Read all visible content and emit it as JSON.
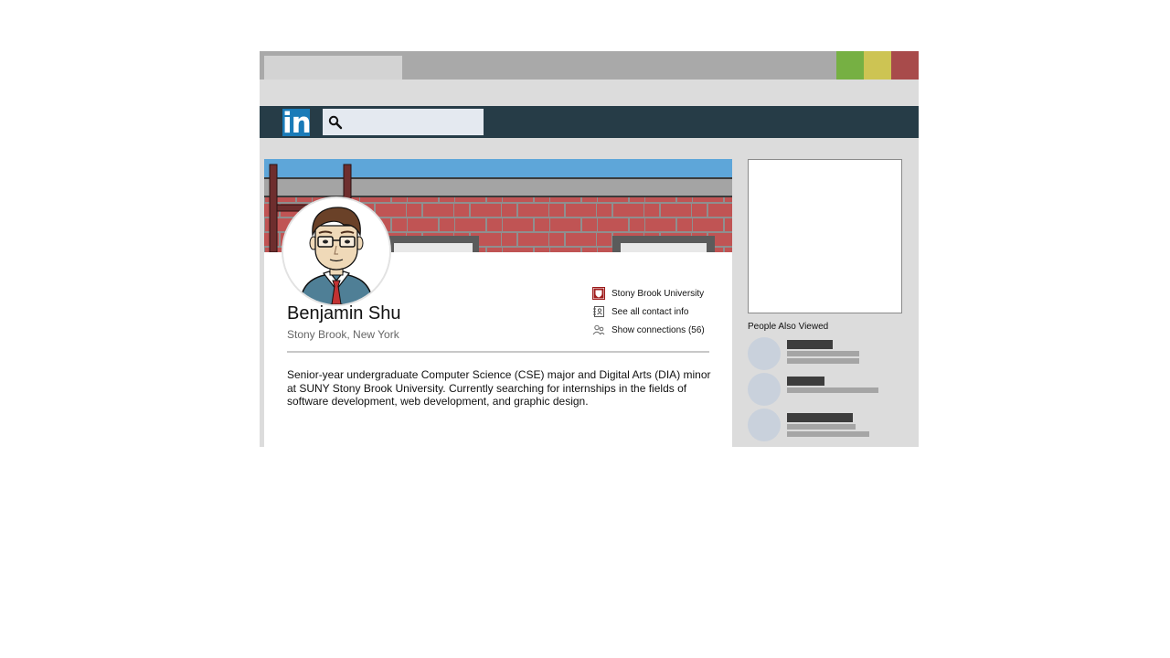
{
  "browser": {
    "window_buttons": [
      {
        "name": "maximize",
        "color": "#76b043"
      },
      {
        "name": "minimize",
        "color": "#cdc453"
      },
      {
        "name": "close",
        "color": "#a84b4b"
      }
    ]
  },
  "navbar": {
    "logo_text": "in",
    "logo_color": "#1a7bb8",
    "background": "#263c47",
    "search": {
      "icon": "search-icon",
      "value": ""
    }
  },
  "profile": {
    "name": "Benjamin Shu",
    "location": "Stony Brook, New York",
    "info": [
      {
        "icon": "university-shield-icon",
        "label": "Stony Brook University"
      },
      {
        "icon": "contact-card-icon",
        "label": "See all contact info"
      },
      {
        "icon": "connections-icon",
        "label": "Show connections (56)"
      }
    ],
    "summary": "Senior-year undergraduate Computer Science (CSE) major and Digital Arts (DIA) minor at SUNY Stony Brook University. Currently searching for internships in the fields of software development, web development, and graphic design."
  },
  "sidebar": {
    "people_also_viewed_title": "People Also Viewed",
    "people": [
      {
        "icon": "avatar-placeholder"
      },
      {
        "icon": "avatar-placeholder"
      },
      {
        "icon": "avatar-placeholder"
      }
    ]
  }
}
